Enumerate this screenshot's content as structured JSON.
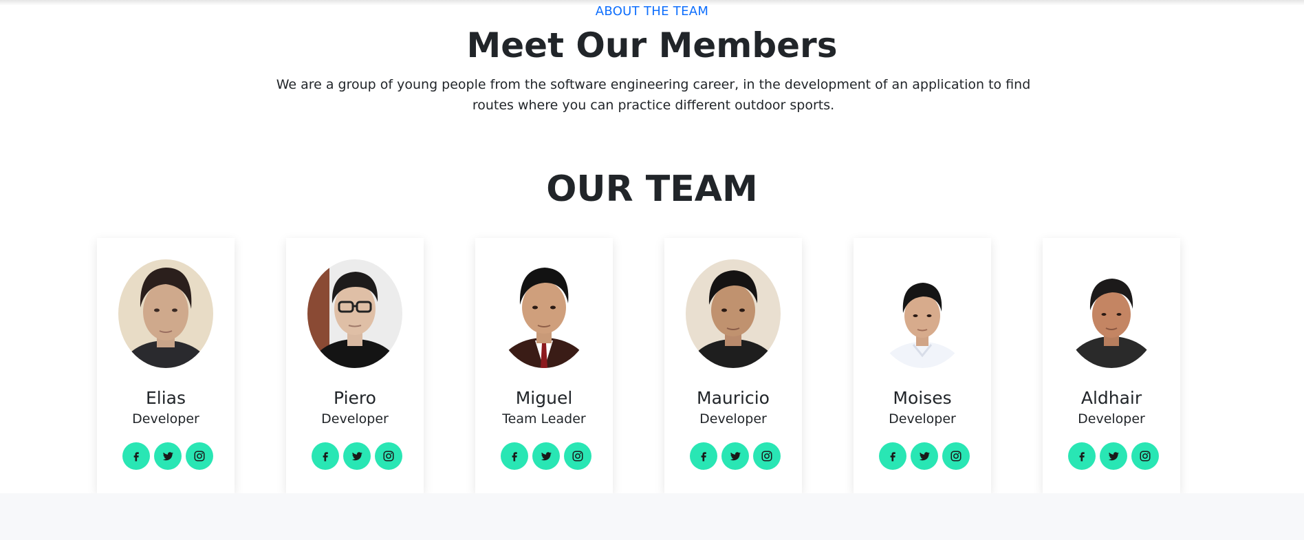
{
  "section": {
    "eyebrow": "ABOUT THE TEAM",
    "title": "Meet Our Members",
    "description": "We are a group of young people from the software engineering career, in the development of an application to find routes where you can practice different outdoor sports."
  },
  "team": {
    "heading": "OUR TEAM",
    "members": [
      {
        "name": "Elias",
        "role": "Developer",
        "photo": "portrait-photo"
      },
      {
        "name": "Piero",
        "role": "Developer",
        "photo": "portrait-photo"
      },
      {
        "name": "Miguel",
        "role": "Team Leader",
        "photo": "portrait-photo"
      },
      {
        "name": "Mauricio",
        "role": "Developer",
        "photo": "portrait-photo"
      },
      {
        "name": "Moises",
        "role": "Developer",
        "photo": "portrait-photo"
      },
      {
        "name": "Aldhair",
        "role": "Developer",
        "photo": "portrait-photo"
      }
    ],
    "social_icons": [
      "facebook-icon",
      "twitter-icon",
      "instagram-icon"
    ]
  },
  "colors": {
    "accent": "#29e6b4",
    "eyebrow": "#0d6efd",
    "text": "#212529",
    "footer_band": "#f7f8fa"
  }
}
